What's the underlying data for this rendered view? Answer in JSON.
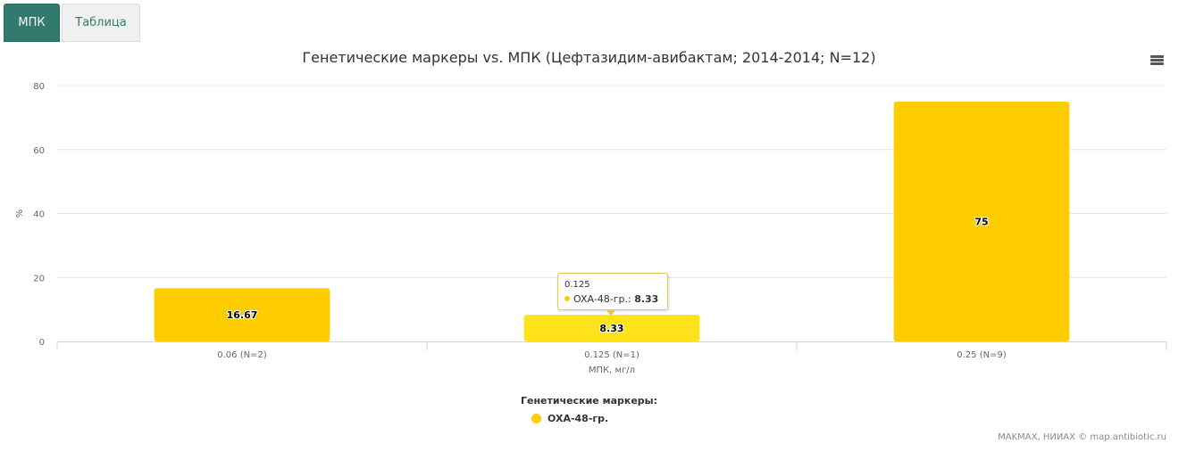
{
  "tabs": [
    {
      "label": "МПК",
      "active": true
    },
    {
      "label": "Таблица",
      "active": false
    }
  ],
  "chart_data": {
    "type": "bar",
    "title": "Генетические маркеры vs. МПК (Цефтазидим-авибактам; 2014-2014; N=12)",
    "xlabel": "МПК, мг/л",
    "ylabel": "%",
    "categories": [
      "0.06 (N=2)",
      "0.125 (N=1)",
      "0.25 (N=9)"
    ],
    "series": [
      {
        "name": "OXA-48-гр.",
        "values": [
          16.67,
          8.33,
          75
        ],
        "color": "#ffcc00"
      }
    ],
    "ylim": [
      0,
      80
    ],
    "yticks": [
      0,
      20,
      40,
      60,
      80
    ],
    "grid": true,
    "highlight_color": "#ffe21a",
    "legend_title": "Генетические маркеры:",
    "legend_placement": "bottom-center"
  },
  "tooltip": {
    "header": "0.125",
    "series": "OXA-48-гр.:",
    "value": "8.33"
  },
  "credits": "MAKMAX, НИИАХ © map.antibiotic.ru"
}
